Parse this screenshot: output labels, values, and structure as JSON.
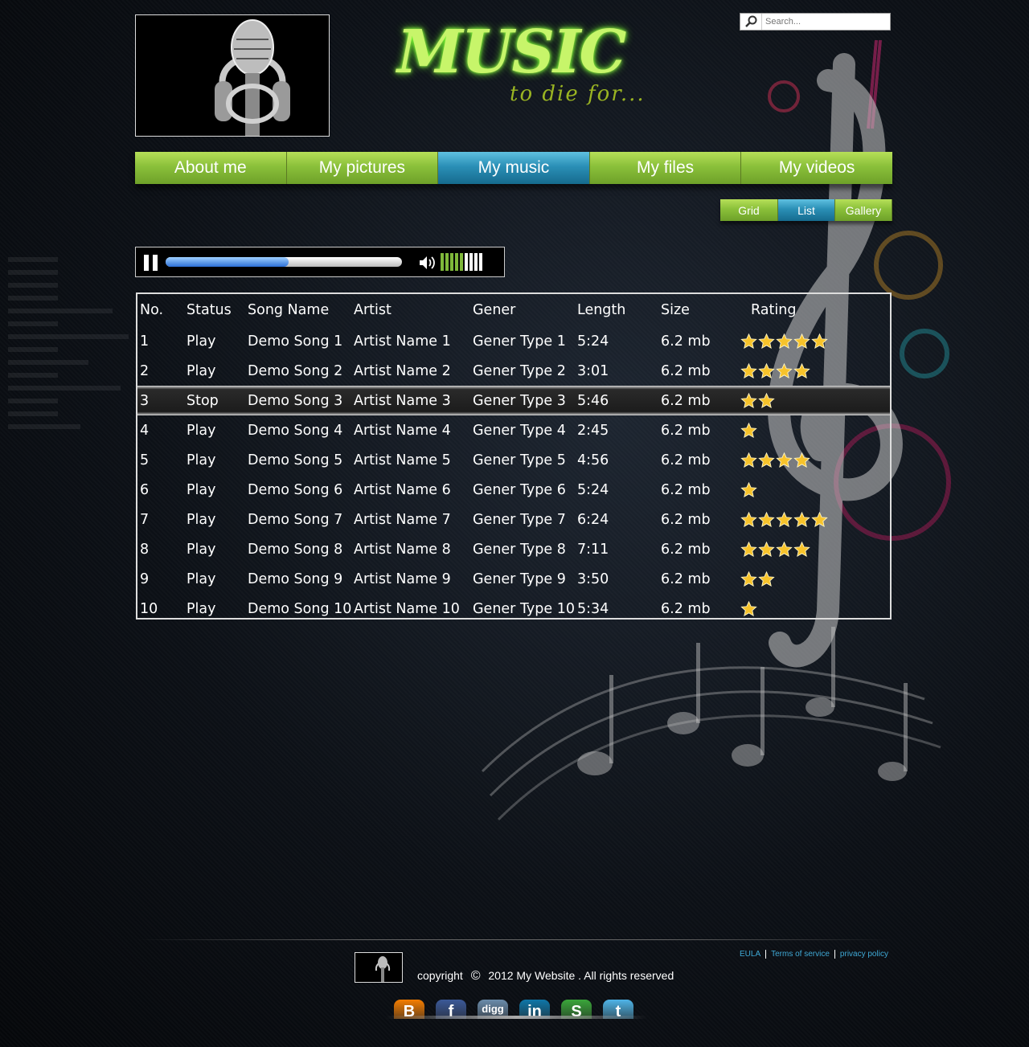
{
  "header": {
    "title": "MUSIC",
    "subtitle": "to die for...",
    "search_placeholder": "Search..."
  },
  "nav": [
    {
      "label": "About me",
      "active": false
    },
    {
      "label": "My pictures",
      "active": false
    },
    {
      "label": "My music",
      "active": true
    },
    {
      "label": "My files",
      "active": false
    },
    {
      "label": "My videos",
      "active": false
    }
  ],
  "views": [
    {
      "label": "Grid",
      "active": false
    },
    {
      "label": "List",
      "active": true
    },
    {
      "label": "Gallery",
      "active": false
    }
  ],
  "player": {
    "progress_fraction": 0.52,
    "volume_level": 5,
    "volume_max": 9
  },
  "table": {
    "headers": [
      "No.",
      "Status",
      "Song Name",
      "Artist",
      "Gener",
      "Length",
      "Size",
      "Rating"
    ],
    "rows": [
      {
        "no": "1",
        "status": "Play",
        "song": "Demo Song 1",
        "artist": "Artist Name 1",
        "gener": "Gener Type 1",
        "length": "5:24",
        "size": "6.2 mb",
        "rating": 5
      },
      {
        "no": "2",
        "status": "Play",
        "song": "Demo Song 2",
        "artist": "Artist Name 2",
        "gener": "Gener Type 2",
        "length": "3:01",
        "size": "6.2 mb",
        "rating": 4
      },
      {
        "no": "3",
        "status": "Stop",
        "song": "Demo Song 3",
        "artist": "Artist Name 3",
        "gener": "Gener Type 3",
        "length": "5:46",
        "size": "6.2 mb",
        "rating": 2,
        "selected": true
      },
      {
        "no": "4",
        "status": "Play",
        "song": "Demo Song 4",
        "artist": "Artist Name 4",
        "gener": "Gener Type 4",
        "length": "2:45",
        "size": "6.2 mb",
        "rating": 1
      },
      {
        "no": "5",
        "status": "Play",
        "song": "Demo Song 5",
        "artist": "Artist Name 5",
        "gener": "Gener Type 5",
        "length": "4:56",
        "size": "6.2 mb",
        "rating": 4
      },
      {
        "no": "6",
        "status": "Play",
        "song": "Demo Song 6",
        "artist": "Artist Name 6",
        "gener": "Gener Type 6",
        "length": "5:24",
        "size": "6.2 mb",
        "rating": 1
      },
      {
        "no": "7",
        "status": "Play",
        "song": "Demo Song 7",
        "artist": "Artist Name 7",
        "gener": "Gener Type 7",
        "length": "6:24",
        "size": "6.2 mb",
        "rating": 5
      },
      {
        "no": "8",
        "status": "Play",
        "song": "Demo Song 8",
        "artist": "Artist Name 8",
        "gener": "Gener Type 8",
        "length": "7:11",
        "size": "6.2 mb",
        "rating": 4
      },
      {
        "no": "9",
        "status": "Play",
        "song": "Demo Song 9",
        "artist": "Artist Name 9",
        "gener": "Gener Type 9",
        "length": "3:50",
        "size": "6.2 mb",
        "rating": 2
      },
      {
        "no": "10",
        "status": "Play",
        "song": "Demo Song 10",
        "artist": "Artist Name 10",
        "gener": "Gener Type 10",
        "length": "5:34",
        "size": "6.2 mb",
        "rating": 1
      }
    ]
  },
  "footer": {
    "copyright_prefix": "copyright",
    "copyright_symbol": "©",
    "copyright_text": "2012 My Website . All rights reserved",
    "links": [
      "EULA",
      "Terms of service",
      "privacy policy"
    ],
    "social": [
      {
        "name": "blogger",
        "glyph": "B",
        "color": "#f57d00"
      },
      {
        "name": "facebook",
        "glyph": "f",
        "color": "#3b5998"
      },
      {
        "name": "digg",
        "glyph": "digg",
        "color": "#6b8cab"
      },
      {
        "name": "linkedin",
        "glyph": "in",
        "color": "#0e76a8"
      },
      {
        "name": "stumbleupon",
        "glyph": "S",
        "color": "#3aa63a"
      },
      {
        "name": "twitter",
        "glyph": "t",
        "color": "#4fb4e8"
      }
    ]
  },
  "colors": {
    "nav_green": "#8ac03a",
    "nav_active_blue": "#2a8fb6",
    "title_green": "#c7f56a",
    "link_blue": "#3fa9d6",
    "star_gold": "#f7c32b"
  }
}
